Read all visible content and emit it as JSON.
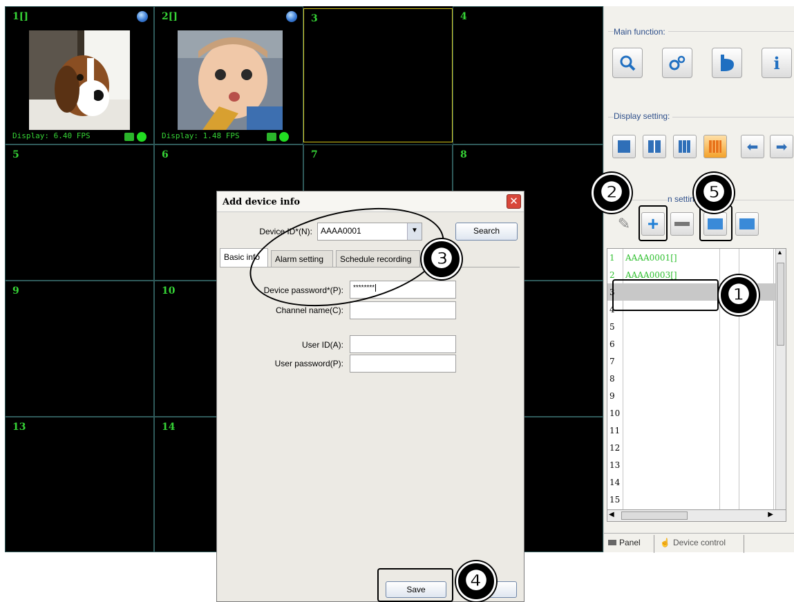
{
  "video_grid": {
    "cells": [
      {
        "num": "1[]",
        "fps": "Display: 6.40 FPS"
      },
      {
        "num": "2[]",
        "fps": "Display: 1.48 FPS"
      },
      {
        "num": "3"
      },
      {
        "num": "4"
      },
      {
        "num": "5"
      },
      {
        "num": "6"
      },
      {
        "num": "7"
      },
      {
        "num": "8"
      },
      {
        "num": "9"
      },
      {
        "num": "10"
      },
      {
        "num": "13"
      },
      {
        "num": "14"
      }
    ]
  },
  "panel": {
    "main_function_label": "Main function:",
    "display_setting_label": "Display setting:",
    "device_setting_label": "n setting:",
    "devices": [
      {
        "n": "1",
        "id": "AAAA0001[]"
      },
      {
        "n": "2",
        "id": "AAAA0003[]"
      },
      {
        "n": "3",
        "id": ""
      },
      {
        "n": "4",
        "id": ""
      },
      {
        "n": "5",
        "id": ""
      },
      {
        "n": "6",
        "id": ""
      },
      {
        "n": "7",
        "id": ""
      },
      {
        "n": "8",
        "id": ""
      },
      {
        "n": "9",
        "id": ""
      },
      {
        "n": "10",
        "id": ""
      },
      {
        "n": "11",
        "id": ""
      },
      {
        "n": "12",
        "id": ""
      },
      {
        "n": "13",
        "id": ""
      },
      {
        "n": "14",
        "id": ""
      },
      {
        "n": "15",
        "id": ""
      }
    ],
    "bottom_tabs": {
      "panel": "Panel",
      "device_control": "Device control"
    }
  },
  "dialog": {
    "title": "Add device info",
    "device_id_label": "Device ID*(N):",
    "device_id_value": "AAAA0001",
    "search_button": "Search",
    "tabs": [
      "Basic info",
      "Alarm setting",
      "Schedule recording"
    ],
    "device_password_label": "Device password*(P):",
    "device_password_value": "********",
    "channel_name_label": "Channel name(C):",
    "user_id_label": "User ID(A):",
    "user_password_label": "User password(P):",
    "save_button": "Save"
  },
  "annotations": [
    "❶",
    "❷",
    "❸",
    "❹",
    "❺"
  ],
  "colors": {
    "grid_green": "#36d336",
    "panel_bg": "#f2f1ec",
    "selected_border": "#d8c81a"
  }
}
